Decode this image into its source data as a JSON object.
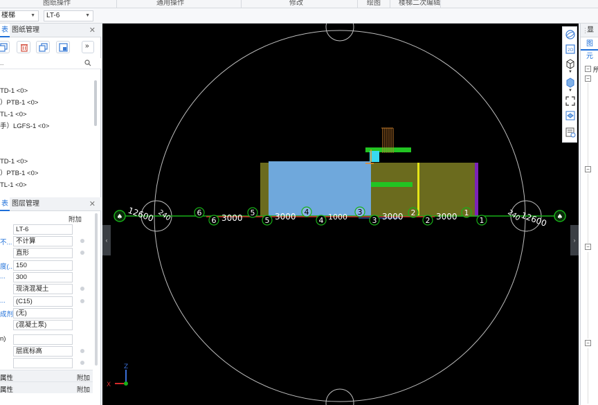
{
  "ribbon": {
    "groups": [
      "图纸操作",
      "通用操作",
      "修改",
      "绘图",
      "楼梯二次编辑"
    ]
  },
  "combos": {
    "category": "楼梯",
    "component": "LT-6"
  },
  "left_panel": {
    "tab1_active": "表",
    "tab1_label": "图纸管理",
    "tab2_active": "表",
    "tab2_label": "图层管理",
    "search_text": "..",
    "tree_group1": [
      "TD-1 <0>",
      "）PTB-1 <0>",
      "TL-1 <0>",
      "手）LGFS-1 <0>"
    ],
    "tree_group2": [
      "TD-1 <0>",
      "）PTB-1 <0>",
      "TL-1 <0>"
    ]
  },
  "properties": {
    "header_right": "附加",
    "rows": [
      {
        "label": "",
        "value": "LT-6"
      },
      {
        "label": "不...",
        "value": "不计算"
      },
      {
        "label": "",
        "value": "直形"
      },
      {
        "label": "度(...",
        "value": "150"
      },
      {
        "label": "...",
        "value": "300"
      },
      {
        "label": "",
        "value": "现浇混凝土"
      },
      {
        "label": "...",
        "value": "(C15)"
      },
      {
        "label": "成剂",
        "value": "(无)"
      },
      {
        "label": "",
        "value": "(混凝土泵)"
      },
      {
        "label": "n)",
        "value": ""
      },
      {
        "label": "",
        "value": "层底标高"
      },
      {
        "label": "",
        "value": ""
      }
    ],
    "section1_label": "属性",
    "section1_right": "附加",
    "section2_label": "属性",
    "section2_right": "附加"
  },
  "right_panel": {
    "tab_label": "显",
    "subtab_label": "图元",
    "tree_first": "所"
  },
  "viewport": {
    "side_left": "‹",
    "side_right": "›",
    "axis_x": "X",
    "axis_z": "Z",
    "dims": [
      "12600",
      "3000",
      "3000",
      "1000",
      "3000",
      "3000",
      "12600",
      "240",
      "240",
      "1000"
    ],
    "axis_numbers_top": [
      "6",
      "5",
      "4",
      "3",
      "2",
      "1"
    ],
    "axis_numbers_bottom": [
      "6",
      "5",
      "4",
      "3",
      "2",
      "1"
    ]
  },
  "colors": {
    "stair_olive": "#6b6b1e",
    "stair_blue": "#6fa8dc",
    "green_line": "#18b018",
    "viewport_bg": "#000000"
  }
}
